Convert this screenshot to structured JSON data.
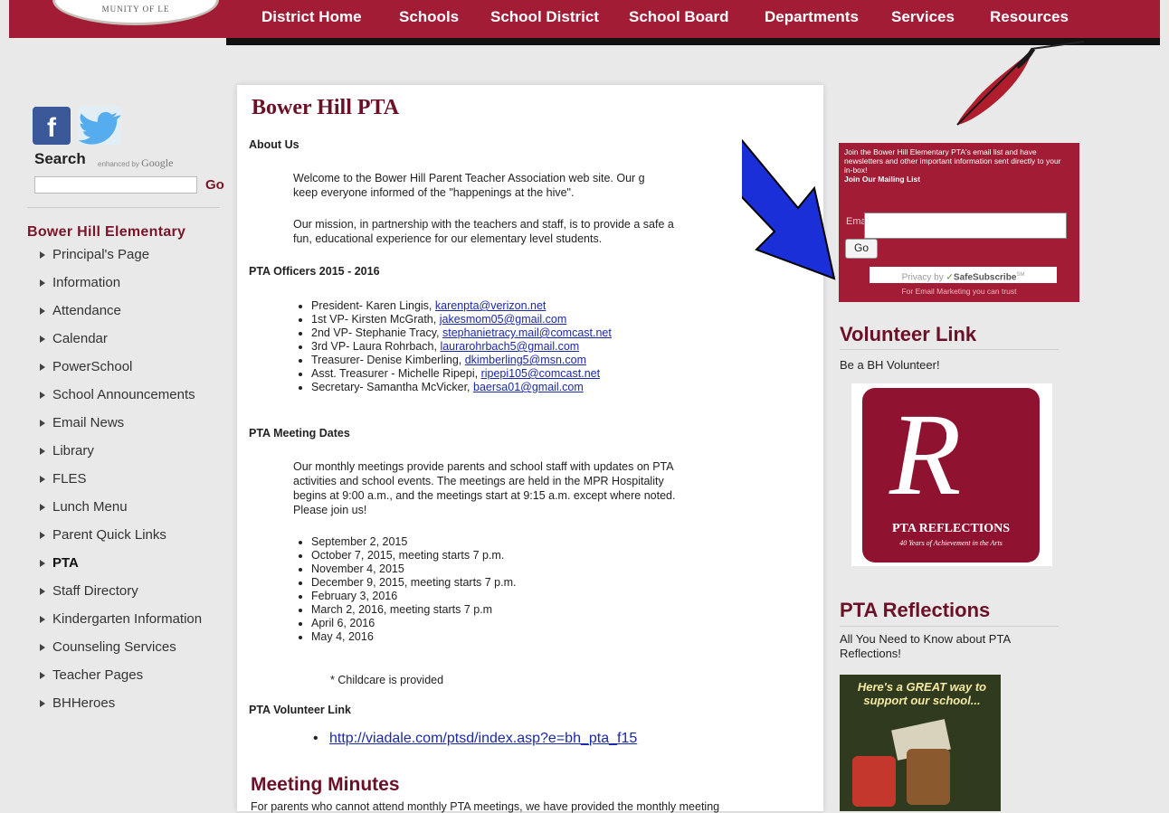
{
  "header": {
    "logo_text": "MUNITY OF LE",
    "nav": [
      "District Home",
      "Schools",
      "School District",
      "School Board",
      "Departments",
      "Services",
      "Resources"
    ]
  },
  "left": {
    "search_title": "Search",
    "search_enhanced": "enhanced by",
    "search_google": "Google",
    "search_go": "Go",
    "school_title": "Bower Hill Elementary",
    "menu": [
      "Principal's Page",
      "Information",
      "Attendance",
      "Calendar",
      "PowerSchool",
      "School Announcements",
      "Email News",
      "Library",
      "FLES",
      "Lunch Menu",
      "Parent Quick Links",
      "PTA",
      "Staff Directory",
      "Kindergarten Information",
      "Counseling Services",
      "Teacher Pages",
      "BHHeroes"
    ]
  },
  "main": {
    "title": "Bower Hill PTA",
    "about_heading": "About Us",
    "about_p1a": "Welcome to the Bower Hill Parent Teacher Association web site. Our g",
    "about_p1b": "keep everyone informed of the \"happenings at the hive\".",
    "about_p2a": "Our mission, in partnership with the teachers and staff, is to provide a safe a",
    "about_p2b": "fun, educational experience for our elementary level students.",
    "officers_heading": "PTA Officers 2015 - 2016",
    "officers": [
      {
        "text": "President- Karen Lingis, ",
        "email": "karenpta@verizon.net"
      },
      {
        "text": "1st VP- Kirsten McGrath, ",
        "email": "jakesmom05@gmail.com"
      },
      {
        "text": "2nd VP- Stephanie Tracy, ",
        "email": "stephanietracy.mail@comcast.net"
      },
      {
        "text": "3rd VP- Laura Rohrbach, ",
        "email": "laurarohrbach5@gmail.com"
      },
      {
        "text": "Treasurer- Denise Kimberling, ",
        "email": "dkimberling5@msn.com"
      },
      {
        "text": "Asst. Treasurer - Michelle Ripepi, ",
        "email": "ripepi105@comcast.net"
      },
      {
        "text": "Secretary- Samantha McVicker, ",
        "email": "baersa01@gmail.com"
      }
    ],
    "meetings_heading": "PTA Meeting Dates",
    "meetings_p": [
      "Our monthly meetings provide parents and school staff with updates on PTA",
      "activities and school events. The meetings are held in the MPR  Hospitality",
      "begins at 9:00 a.m., and the meetings start at 9:15 a.m. except where noted.",
      "Please join us!"
    ],
    "dates": [
      "September 2, 2015",
      "October 7, 2015, meeting starts 7 p.m.",
      "November 4, 2015",
      "December 9, 2015, meeting starts 7 p.m.",
      "February 3, 2016",
      "March 2, 2016, meeting starts 7 p.m",
      "April 6, 2016",
      "May 4, 2016"
    ],
    "childcare": "* Childcare is provided",
    "volunteer_heading": "PTA Volunteer Link",
    "volunteer_link": "http://viadale.com/ptsd/index.asp?e=bh_pta_f15",
    "minutes_title": "Meeting Minutes",
    "minutes_text": "For parents who cannot attend monthly PTA meetings, we have provided the monthly meeting"
  },
  "right": {
    "signup_intro": "Join the Bower Hill Elementary PTA's email list and have newsletters and other important information sent directly to your in-box!",
    "signup_join": "Join Our Mailing List",
    "email_label": "Email:",
    "go_button": "Go",
    "privacy_prefix": "Privacy by",
    "privacy_brand": "SafeSubscribe",
    "privacy_sm": "SM",
    "trust": "For Email Marketing you can trust",
    "volunteer_title": "Volunteer Link",
    "volunteer_text": "Be a BH Volunteer!",
    "reflections_logo_title": "PTA REFLECTIONS",
    "reflections_logo_sub": "40 Years of Achievement in the Arts",
    "reflections_title": "PTA Reflections",
    "reflections_text": "All You Need to Know about PTA Reflections!",
    "promo_text": "Here's a GREAT way to support our school..."
  },
  "colors": {
    "brand": "#a21c35",
    "heading": "#6b1026",
    "link": "#1b28a8",
    "arrow": "#1a2fd8"
  },
  "icons": [
    "facebook-icon",
    "twitter-icon",
    "feather-icon",
    "blue-arrow-annotation"
  ]
}
